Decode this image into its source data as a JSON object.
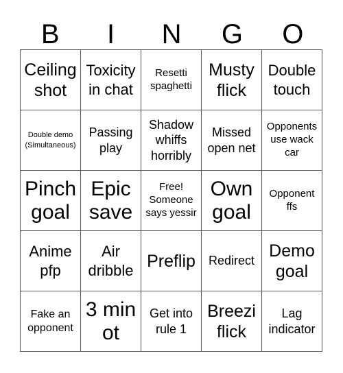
{
  "header": [
    "B",
    "I",
    "N",
    "G",
    "O"
  ],
  "cells": [
    "Ceiling shot",
    "Toxicity in chat",
    "Resetti spaghetti",
    "Musty flick",
    "Double touch",
    "Double demo (Simultaneous)",
    "Passing play",
    "Shadow whiffs horribly",
    "Missed open net",
    "Opponents use wack car",
    "Pinch goal",
    "Epic save",
    "Free! Someone says yessir",
    "Own goal",
    "Opponent ffs",
    "Anime pfp",
    "Air dribble",
    "Preflip",
    "Redirect",
    "Demo goal",
    "Fake an opponent",
    "3 min ot",
    "Get into rule 1",
    "Breezi flick",
    "Lag indicator"
  ]
}
